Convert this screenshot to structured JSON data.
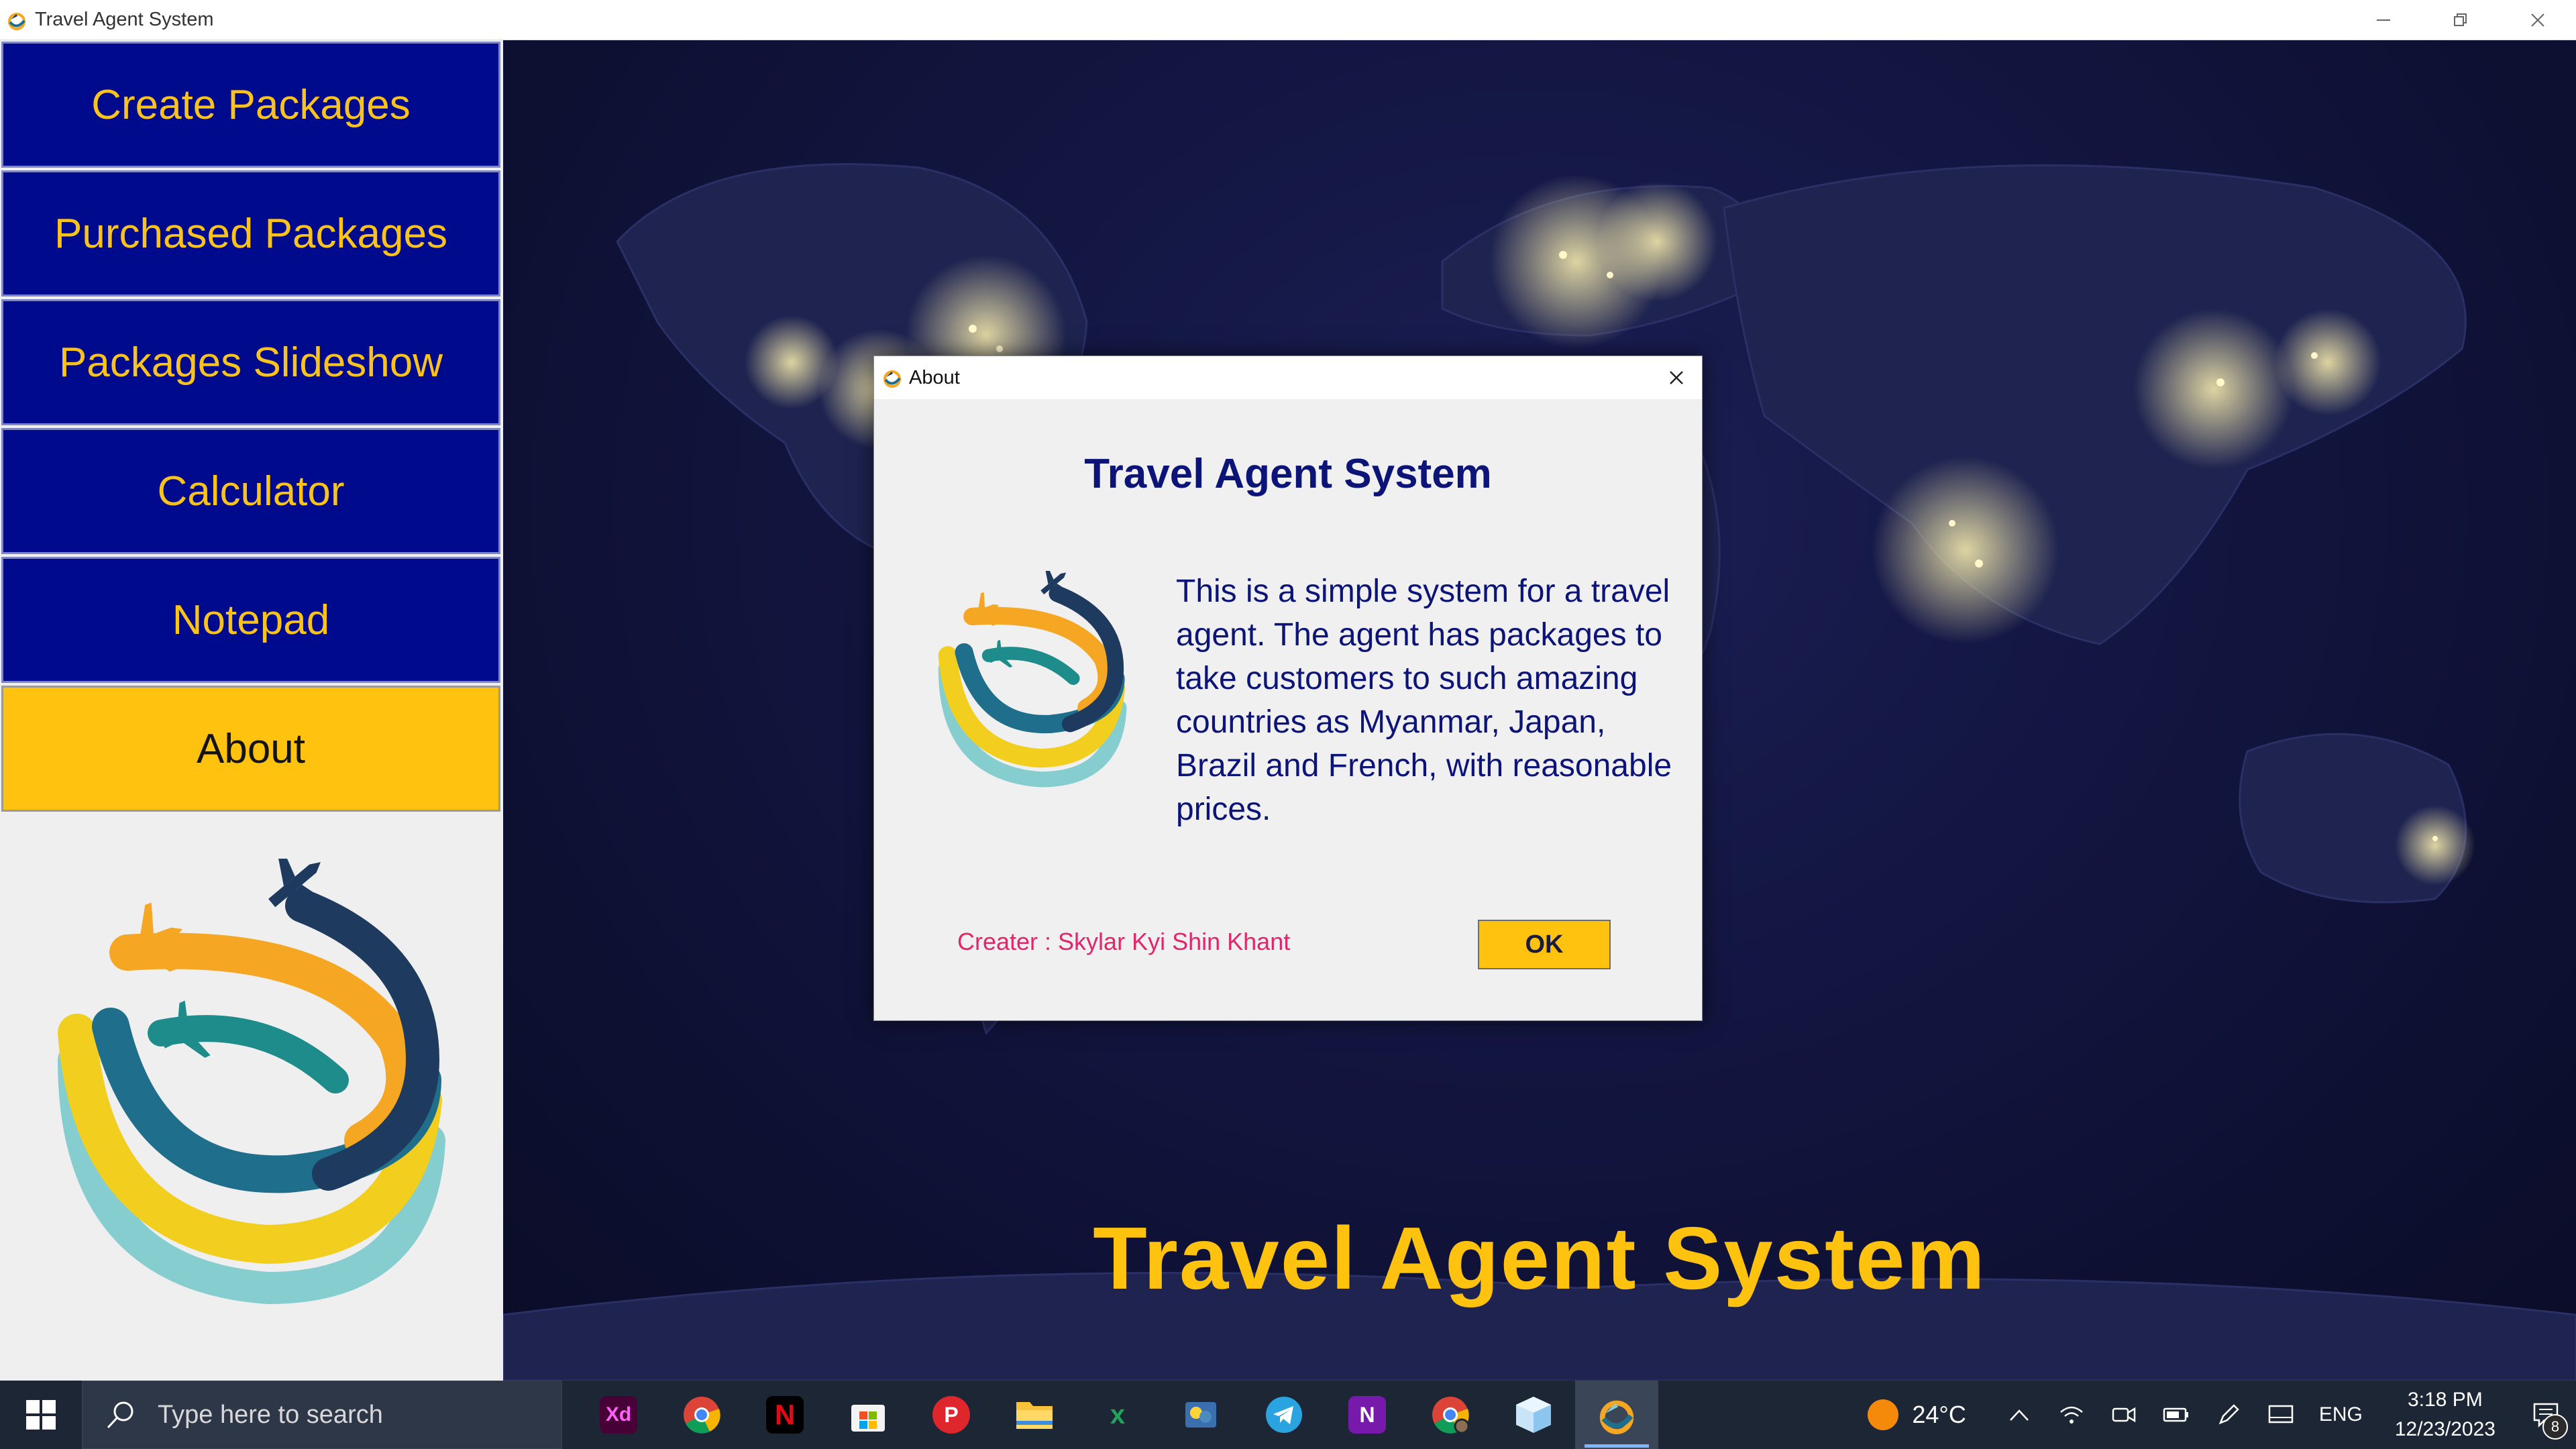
{
  "window": {
    "title": "Travel Agent System",
    "controls": [
      "minimize-icon",
      "restore-icon",
      "close-icon"
    ]
  },
  "sidebar": {
    "items": [
      {
        "label": "Create Packages",
        "active": false
      },
      {
        "label": "Purchased Packages",
        "active": false
      },
      {
        "label": "Packages Slideshow",
        "active": false
      },
      {
        "label": "Calculator",
        "active": false
      },
      {
        "label": "Notepad",
        "active": false
      },
      {
        "label": "About",
        "active": true
      }
    ]
  },
  "main": {
    "title": "Travel Agent System"
  },
  "about_dialog": {
    "window_title": "About",
    "heading": "Travel Agent System",
    "description": "This is a simple system for a travel agent. The agent has packages to take customers to such amazing countries as Myanmar, Japan, Brazil and French, with reasonable prices.",
    "creator": "Creater : Skylar Kyi Shin Khant",
    "ok_label": "OK"
  },
  "taskbar": {
    "search_placeholder": "Type here to search",
    "apps": [
      "adobe-xd",
      "chrome",
      "netflix",
      "microsoft-store",
      "postman",
      "excel",
      "file-explorer",
      "python-idle",
      "telegram",
      "onenote",
      "chrome-profile",
      "cube-app",
      "travel-agent-system"
    ],
    "active_app": "travel-agent-system",
    "weather": {
      "temp": "24°C"
    },
    "language": "ENG",
    "time": "3:18 PM",
    "date": "12/23/2023",
    "notification_count": "8"
  },
  "colors": {
    "nav_bg": "#000a8c",
    "nav_text": "#f9c21c",
    "accent": "#ffc20e",
    "dialog_text": "#0c1478",
    "creator_text": "#e2266a"
  }
}
